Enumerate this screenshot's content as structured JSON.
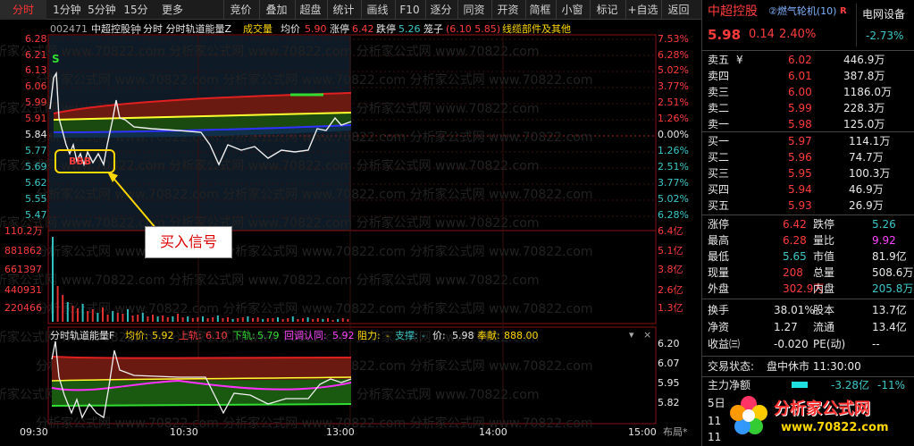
{
  "toolbar": {
    "items": [
      "分时",
      "1分钟",
      "5分钟",
      "15分钟",
      "更多",
      "竞价",
      "叠加",
      "超盘",
      "统计",
      "画线",
      "F10",
      "逐分",
      "同资",
      "开资",
      "简框",
      "小窗",
      "标记",
      "+自选",
      "返回"
    ]
  },
  "header": {
    "code": "002471",
    "name": "中超控股",
    "indicator": "分时 分时轨道能量Z",
    "vol_label": "成交量",
    "avg_label": "均价",
    "avg": "5.90",
    "limit_up_label": "涨停",
    "limit_up": "6.42",
    "limit_down_label": "跌停",
    "limit_down": "5.26",
    "concept_label": "笼子",
    "concept_vals": "(6.10 5.85)",
    "sector": "线缆部件及其他"
  },
  "price_axis": {
    "left": [
      "6.28",
      "6.21",
      "6.13",
      "6.06",
      "5.99",
      "5.91",
      "5.84",
      "5.77",
      "5.69",
      "5.62",
      "5.55",
      "5.47"
    ],
    "right": [
      "7.53%",
      "6.28%",
      "5.02%",
      "3.77%",
      "2.51%",
      "1.26%",
      "0.00%",
      "1.26%",
      "2.51%",
      "3.77%",
      "5.02%",
      "6.28%"
    ]
  },
  "volume_axis": {
    "left": [
      "110.2万",
      "881862",
      "661397",
      "440931",
      "220466"
    ],
    "right": [
      "6.4亿",
      "5.1亿",
      "3.8亿",
      "2.6亿",
      "1.3亿"
    ]
  },
  "sub": {
    "title": "分时轨道能量F",
    "avg_label": "均价:",
    "avg": "5.92",
    "upper_label": "上轨:",
    "upper": "6.10",
    "lower_label": "下轨:",
    "lower": "5.79",
    "pullback_label": "回调认同:",
    "pullback": "5.92",
    "resist_label": "阻力:",
    "resist": "-",
    "support_label": "支撑:",
    "support": "-",
    "price_label": "价:",
    "price": "5.98",
    "contrib_label": "奉献:",
    "contrib": "888.00",
    "axis": [
      "6.20",
      "6.07",
      "5.95",
      "5.82"
    ]
  },
  "time_axis": [
    "09:30",
    "10:30",
    "13:00",
    "14:00",
    "15:00"
  ],
  "layout_label": "布局*",
  "signal": {
    "text": "BBB",
    "callout": "买入信号"
  },
  "watermark": "分析家公式网 www.70822.com",
  "quote": {
    "name": "中超控股",
    "sector": "②燃气轮机(10)",
    "r": "R",
    "price": "5.98",
    "change": "0.14",
    "pct": "2.40%",
    "industry": "电网设备",
    "industry_pct": "-2.73%",
    "asks": [
      {
        "label": "卖五",
        "sym": "¥",
        "price": "6.02",
        "vol": "446.9万"
      },
      {
        "label": "卖四",
        "sym": "",
        "price": "6.01",
        "vol": "387.8万"
      },
      {
        "label": "卖三",
        "sym": "",
        "price": "6.00",
        "vol": "1186.0万"
      },
      {
        "label": "卖二",
        "sym": "",
        "price": "5.99",
        "vol": "228.3万"
      },
      {
        "label": "卖一",
        "sym": "",
        "price": "5.98",
        "vol": "125.0万"
      }
    ],
    "bids": [
      {
        "label": "买一",
        "price": "5.97",
        "vol": "114.1万"
      },
      {
        "label": "买二",
        "price": "5.96",
        "vol": "74.7万"
      },
      {
        "label": "买三",
        "price": "5.95",
        "vol": "100.3万"
      },
      {
        "label": "买四",
        "price": "5.94",
        "vol": "46.9万"
      },
      {
        "label": "买五",
        "price": "5.93",
        "vol": "26.9万"
      }
    ],
    "stats": [
      {
        "l1": "涨停",
        "v1": "6.42",
        "c1": "red",
        "l2": "跌停",
        "v2": "5.26",
        "c2": "grn"
      },
      {
        "l1": "最高",
        "v1": "6.28",
        "c1": "red",
        "l2": "量比",
        "v2": "9.92",
        "c2": "mag"
      },
      {
        "l1": "最低",
        "v1": "5.65",
        "c1": "grn",
        "l2": "市值",
        "v2": "81.9亿",
        "c2": "wht"
      },
      {
        "l1": "现量",
        "v1": "208",
        "c1": "red",
        "l2": "总量",
        "v2": "508.6万",
        "c2": "wht"
      },
      {
        "l1": "外盘",
        "v1": "302.9万",
        "c1": "red",
        "l2": "内盘",
        "v2": "205.8万",
        "c2": "grn"
      }
    ],
    "stats2": [
      {
        "l1": "换手",
        "v1": "38.01%",
        "l2": "股本",
        "v2": "13.7亿"
      },
      {
        "l1": "净资",
        "v1": "1.27",
        "l2": "流通",
        "v2": "13.4亿"
      },
      {
        "l1": "收益㈢",
        "v1": "-0.020",
        "l2": "PE(动)",
        "v2": "--"
      }
    ],
    "trade_status_label": "交易状态:",
    "trade_status": "盘中休市 11:30:00",
    "net_label": "主力净额",
    "net": "-3.28亿",
    "net_pct": "-11%",
    "day5": "5日",
    "t1": "11",
    "t2": "11",
    "logo": "分析家公式网",
    "logo_url": "www.70822.com"
  }
}
